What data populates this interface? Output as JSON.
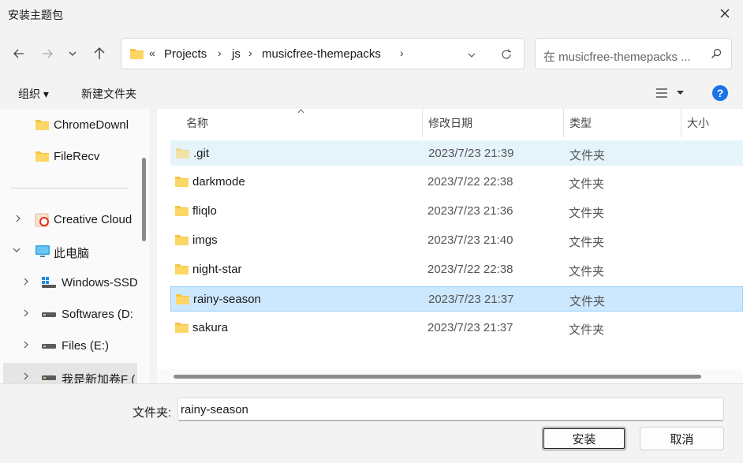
{
  "window": {
    "title": "安装主题包"
  },
  "address": {
    "overflow": "«",
    "crumbs": [
      "Projects",
      "js",
      "musicfree-themepacks"
    ]
  },
  "search": {
    "placeholder": "在 musicfree-themepacks ..."
  },
  "toolbar": {
    "organize": "组织 ▾",
    "new_folder": "新建文件夹"
  },
  "sidebar": {
    "items": [
      {
        "label": "ChromeDownl",
        "icon": "folder-icon"
      },
      {
        "label": "FileRecv",
        "icon": "folder-icon"
      },
      {
        "label": "Creative Cloud",
        "icon": "creative-cloud-icon"
      },
      {
        "label": "此电脑",
        "icon": "pc-icon"
      },
      {
        "label": "Windows-SSD",
        "icon": "windows-drive-icon"
      },
      {
        "label": "Softwares (D:",
        "icon": "drive-icon"
      },
      {
        "label": "Files (E:)",
        "icon": "drive-icon"
      },
      {
        "label": "我是新加卷F (",
        "icon": "drive-icon"
      }
    ]
  },
  "columns": {
    "name": "名称",
    "date": "修改日期",
    "type": "类型",
    "size": "大小"
  },
  "files": [
    {
      "name": ".git",
      "date": "2023/7/23 21:39",
      "type": "文件夹",
      "state": "hover"
    },
    {
      "name": "darkmode",
      "date": "2023/7/22 22:38",
      "type": "文件夹",
      "state": ""
    },
    {
      "name": "fliqlo",
      "date": "2023/7/23 21:36",
      "type": "文件夹",
      "state": ""
    },
    {
      "name": "imgs",
      "date": "2023/7/23 21:40",
      "type": "文件夹",
      "state": ""
    },
    {
      "name": "night-star",
      "date": "2023/7/22 22:38",
      "type": "文件夹",
      "state": ""
    },
    {
      "name": "rainy-season",
      "date": "2023/7/23 21:37",
      "type": "文件夹",
      "state": "selected"
    },
    {
      "name": "sakura",
      "date": "2023/7/23 21:37",
      "type": "文件夹",
      "state": ""
    }
  ],
  "footer": {
    "folder_label": "文件夹:",
    "folder_value": "rainy-season",
    "install": "安装",
    "cancel": "取消"
  },
  "colors": {
    "folder": "#f6c445",
    "selected_bg": "#cce8ff",
    "hover_bg": "#e5f3fb",
    "help": "#1a73e8"
  }
}
